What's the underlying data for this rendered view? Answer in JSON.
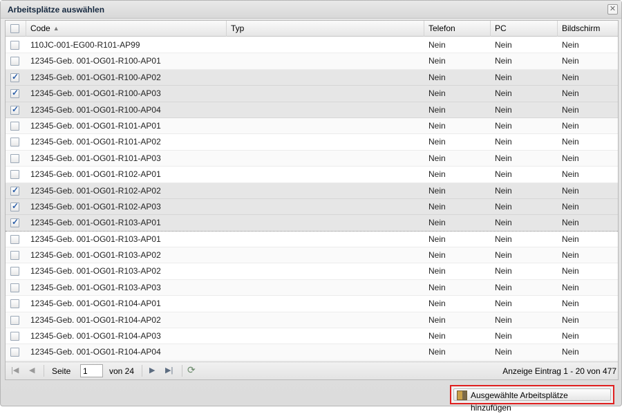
{
  "window": {
    "title": "Arbeitsplätze auswählen",
    "close": "✕"
  },
  "columns": {
    "code": "Code",
    "typ": "Typ",
    "telefon": "Telefon",
    "pc": "PC",
    "bildschirm": "Bildschirm"
  },
  "rows": [
    {
      "code": "110JC-001-EG00-R101-AP99",
      "typ": "",
      "telefon": "Nein",
      "pc": "Nein",
      "bildschirm": "Nein",
      "checked": false
    },
    {
      "code": "12345-Geb. 001-OG01-R100-AP01",
      "typ": "",
      "telefon": "Nein",
      "pc": "Nein",
      "bildschirm": "Nein",
      "checked": false
    },
    {
      "code": "12345-Geb. 001-OG01-R100-AP02",
      "typ": "",
      "telefon": "Nein",
      "pc": "Nein",
      "bildschirm": "Nein",
      "checked": true
    },
    {
      "code": "12345-Geb. 001-OG01-R100-AP03",
      "typ": "",
      "telefon": "Nein",
      "pc": "Nein",
      "bildschirm": "Nein",
      "checked": true
    },
    {
      "code": "12345-Geb. 001-OG01-R100-AP04",
      "typ": "",
      "telefon": "Nein",
      "pc": "Nein",
      "bildschirm": "Nein",
      "checked": true
    },
    {
      "code": "12345-Geb. 001-OG01-R101-AP01",
      "typ": "",
      "telefon": "Nein",
      "pc": "Nein",
      "bildschirm": "Nein",
      "checked": false
    },
    {
      "code": "12345-Geb. 001-OG01-R101-AP02",
      "typ": "",
      "telefon": "Nein",
      "pc": "Nein",
      "bildschirm": "Nein",
      "checked": false
    },
    {
      "code": "12345-Geb. 001-OG01-R101-AP03",
      "typ": "",
      "telefon": "Nein",
      "pc": "Nein",
      "bildschirm": "Nein",
      "checked": false
    },
    {
      "code": "12345-Geb. 001-OG01-R102-AP01",
      "typ": "",
      "telefon": "Nein",
      "pc": "Nein",
      "bildschirm": "Nein",
      "checked": false
    },
    {
      "code": "12345-Geb. 001-OG01-R102-AP02",
      "typ": "",
      "telefon": "Nein",
      "pc": "Nein",
      "bildschirm": "Nein",
      "checked": true
    },
    {
      "code": "12345-Geb. 001-OG01-R102-AP03",
      "typ": "",
      "telefon": "Nein",
      "pc": "Nein",
      "bildschirm": "Nein",
      "checked": true
    },
    {
      "code": "12345-Geb. 001-OG01-R103-AP01",
      "typ": "",
      "telefon": "Nein",
      "pc": "Nein",
      "bildschirm": "Nein",
      "checked": true
    },
    {
      "code": "12345-Geb. 001-OG01-R103-AP01",
      "typ": "",
      "telefon": "Nein",
      "pc": "Nein",
      "bildschirm": "Nein",
      "checked": false
    },
    {
      "code": "12345-Geb. 001-OG01-R103-AP02",
      "typ": "",
      "telefon": "Nein",
      "pc": "Nein",
      "bildschirm": "Nein",
      "checked": false
    },
    {
      "code": "12345-Geb. 001-OG01-R103-AP02",
      "typ": "",
      "telefon": "Nein",
      "pc": "Nein",
      "bildschirm": "Nein",
      "checked": false
    },
    {
      "code": "12345-Geb. 001-OG01-R103-AP03",
      "typ": "",
      "telefon": "Nein",
      "pc": "Nein",
      "bildschirm": "Nein",
      "checked": false
    },
    {
      "code": "12345-Geb. 001-OG01-R104-AP01",
      "typ": "",
      "telefon": "Nein",
      "pc": "Nein",
      "bildschirm": "Nein",
      "checked": false
    },
    {
      "code": "12345-Geb. 001-OG01-R104-AP02",
      "typ": "",
      "telefon": "Nein",
      "pc": "Nein",
      "bildschirm": "Nein",
      "checked": false
    },
    {
      "code": "12345-Geb. 001-OG01-R104-AP03",
      "typ": "",
      "telefon": "Nein",
      "pc": "Nein",
      "bildschirm": "Nein",
      "checked": false
    },
    {
      "code": "12345-Geb. 001-OG01-R104-AP04",
      "typ": "",
      "telefon": "Nein",
      "pc": "Nein",
      "bildschirm": "Nein",
      "checked": false
    }
  ],
  "pager": {
    "page_label": "Seite",
    "page_value": "1",
    "of_label": "von 24",
    "info": "Anzeige Eintrag 1 - 20 von 477"
  },
  "footer": {
    "add_button": "Ausgewählte Arbeitsplätze hinzufügen"
  }
}
